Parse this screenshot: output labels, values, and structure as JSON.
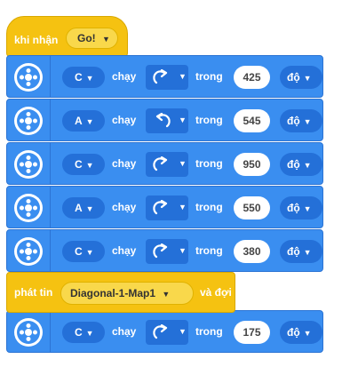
{
  "hat": {
    "label": "khi nhận",
    "message": "Go!"
  },
  "motors": [
    {
      "port": "C",
      "run_label": "chạy",
      "direction": "clockwise",
      "for_label": "trong",
      "value": "425",
      "unit": "độ"
    },
    {
      "port": "A",
      "run_label": "chạy",
      "direction": "counterclockwise",
      "for_label": "trong",
      "value": "545",
      "unit": "độ"
    },
    {
      "port": "C",
      "run_label": "chạy",
      "direction": "clockwise",
      "for_label": "trong",
      "value": "950",
      "unit": "độ"
    },
    {
      "port": "A",
      "run_label": "chạy",
      "direction": "clockwise",
      "for_label": "trong",
      "value": "550",
      "unit": "độ"
    },
    {
      "port": "C",
      "run_label": "chạy",
      "direction": "clockwise",
      "for_label": "trong",
      "value": "380",
      "unit": "độ"
    }
  ],
  "broadcast": {
    "prefix": "phát tin",
    "message": "Diagonal-1-Map1",
    "suffix": "và đợi"
  },
  "last_motor": {
    "port": "C",
    "run_label": "chạy",
    "direction": "clockwise",
    "for_label": "trong",
    "value": "175",
    "unit": "độ"
  },
  "colors": {
    "event": "#F5C211",
    "motor": "#3A8EF0",
    "motor_dark": "#2470D8"
  },
  "icons": {
    "motor": "motor-icon",
    "dropdown": "chevron-down-icon",
    "cw": "rotate-clockwise-icon",
    "ccw": "rotate-counterclockwise-icon"
  }
}
